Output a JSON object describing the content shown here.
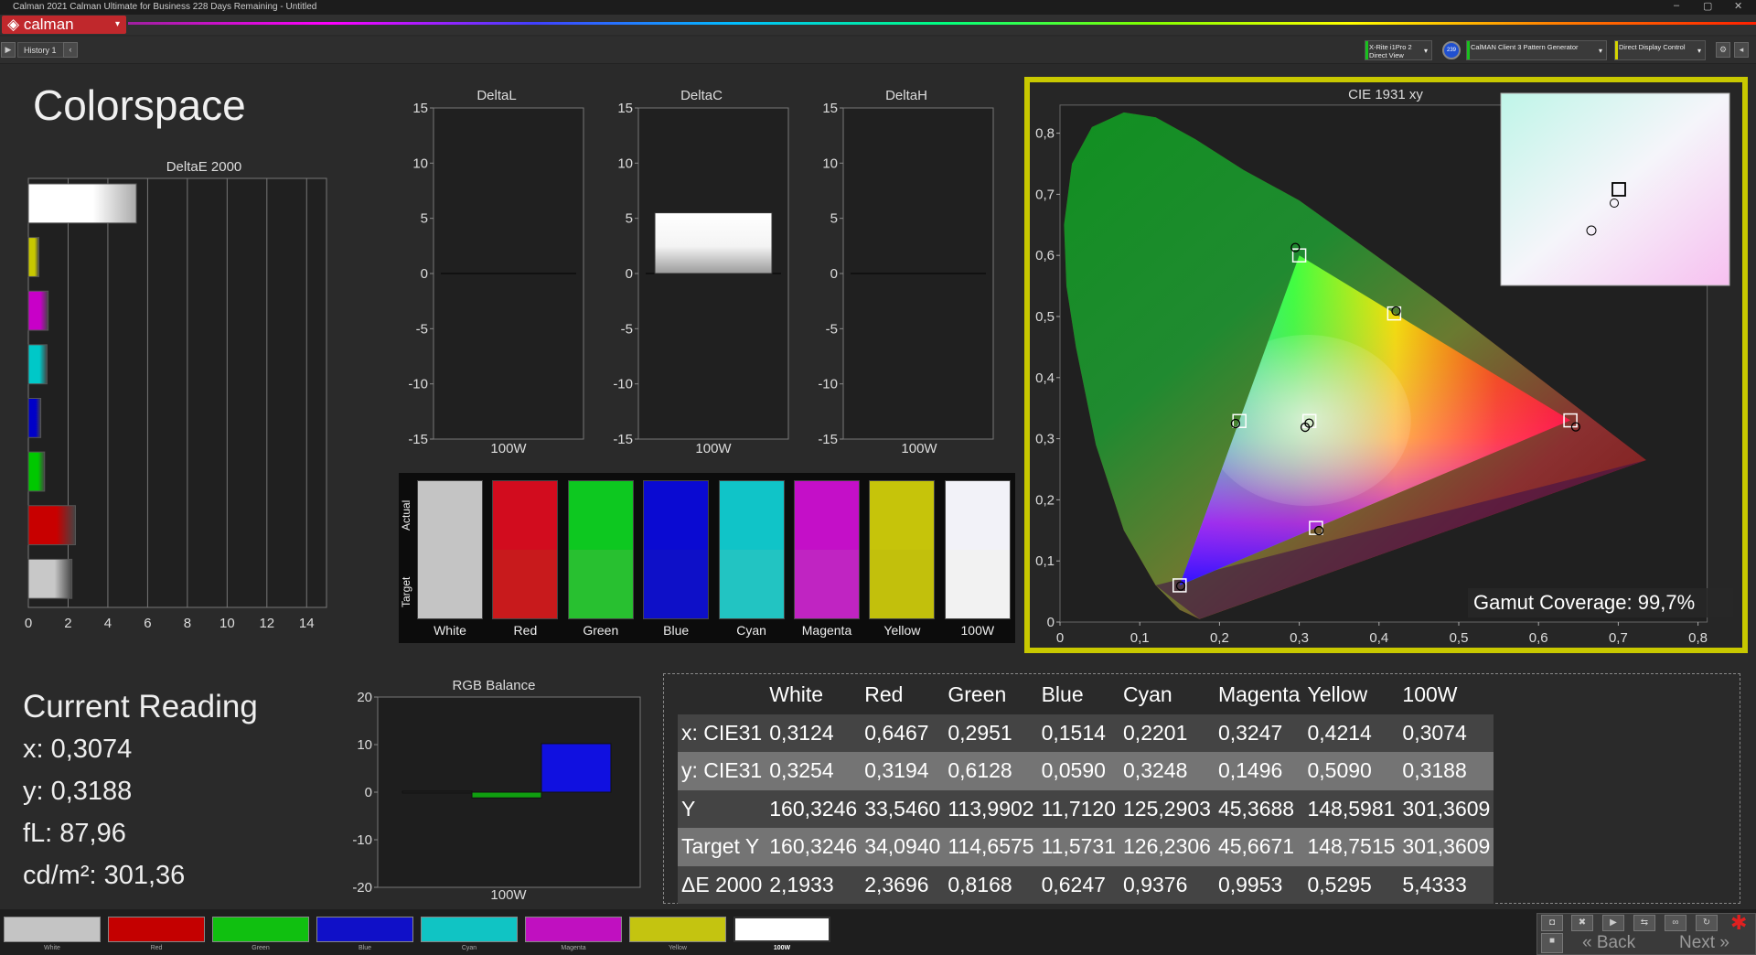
{
  "window": {
    "title": "Calman 2021 Calman Ultimate for Business 228 Days Remaining  - Untitled",
    "minimize": "–",
    "maximize": "▢",
    "close": "✕"
  },
  "brand": {
    "logo": "calman",
    "logo_arrow": "▾"
  },
  "toolbar": {
    "back_arrow": "▶",
    "history_tab": "History 1",
    "history_tab_button": "‹",
    "devices": [
      {
        "line1": "X-Rite i1Pro 2",
        "line2": "Direct View",
        "color": "#19c01e"
      },
      {
        "line1": "CalMAN Client 3 Pattern Generator",
        "line2": "",
        "color": "#19c01e"
      },
      {
        "line1": "Direct Display Control",
        "line2": "",
        "color": "#d6d600"
      }
    ],
    "device_round_label": "239"
  },
  "page": {
    "title": "Colorspace"
  },
  "deltae": {
    "title": "DeltaE 2000",
    "ticks": [
      "0",
      "2",
      "4",
      "6",
      "8",
      "10",
      "12",
      "14"
    ],
    "xlim": [
      0,
      15
    ]
  },
  "deltas": {
    "ticks": [
      "15",
      "10",
      "5",
      "0",
      "-5",
      "-10",
      "-15"
    ],
    "charts": [
      {
        "title": "DeltaL",
        "label": "100W"
      },
      {
        "title": "DeltaC",
        "label": "100W"
      },
      {
        "title": "DeltaH",
        "label": "100W"
      }
    ]
  },
  "swatches": {
    "actual_label": "Actual",
    "target_label": "Target",
    "items": [
      {
        "label": "White",
        "actual": "#c4c4c4",
        "target": "#c4c4c4"
      },
      {
        "label": "Red",
        "actual": "#d20c1e",
        "target": "#c81a1c"
      },
      {
        "label": "Green",
        "actual": "#0dc820",
        "target": "#28c030"
      },
      {
        "label": "Blue",
        "actual": "#0a0ad2",
        "target": "#0e10c8"
      },
      {
        "label": "Cyan",
        "actual": "#10c4c8",
        "target": "#22c4c2"
      },
      {
        "label": "Magenta",
        "actual": "#c40fc8",
        "target": "#c024c2"
      },
      {
        "label": "Yellow",
        "actual": "#c6c40a",
        "target": "#c2c00c"
      },
      {
        "label": "100W",
        "actual": "#f2f2f8",
        "target": "#f2f2f2"
      }
    ]
  },
  "cie": {
    "title": "CIE 1931 xy",
    "xticks": [
      "0",
      "0,1",
      "0,2",
      "0,3",
      "0,4",
      "0,5",
      "0,6",
      "0,7",
      "0,8"
    ],
    "yticks": [
      "0",
      "0,1",
      "0,2",
      "0,3",
      "0,4",
      "0,5",
      "0,6",
      "0,7",
      "0,8"
    ],
    "gamut_coverage_label": "Gamut Coverage:",
    "gamut_coverage_value": "99,7%"
  },
  "current_reading": {
    "title": "Current Reading",
    "x": "x: 0,3074",
    "y": "y: 0,3188",
    "fL": "fL: 87,96",
    "cdm2": "cd/m²: 301,36"
  },
  "rgb_balance": {
    "title": "RGB Balance",
    "ticks": [
      "20",
      "10",
      "0",
      "-10",
      "-20"
    ],
    "label": "100W",
    "ylim": [
      -20,
      20
    ],
    "values": {
      "red": 0.2,
      "green": -1.2,
      "blue": 10.2
    }
  },
  "table": {
    "headers": [
      "",
      "White",
      "Red",
      "Green",
      "Blue",
      "Cyan",
      "Magenta",
      "Yellow",
      "100W"
    ],
    "rows": [
      [
        "x: CIE31",
        "0,3124",
        "0,6467",
        "0,2951",
        "0,1514",
        "0,2201",
        "0,3247",
        "0,4214",
        "0,3074"
      ],
      [
        "y: CIE31",
        "0,3254",
        "0,3194",
        "0,6128",
        "0,0590",
        "0,3248",
        "0,1496",
        "0,5090",
        "0,3188"
      ],
      [
        "Y",
        "160,3246",
        "33,5460",
        "113,9902",
        "11,7120",
        "125,2903",
        "45,3688",
        "148,5981",
        "301,3609"
      ],
      [
        "Target Y",
        "160,3246",
        "34,0940",
        "114,6575",
        "11,5731",
        "126,2306",
        "45,6671",
        "148,7515",
        "301,3609"
      ],
      [
        "ΔE 2000",
        "2,1933",
        "2,3696",
        "0,8168",
        "0,6247",
        "0,9376",
        "0,9953",
        "0,5295",
        "5,4333"
      ]
    ]
  },
  "bottom": {
    "swatches": [
      {
        "label": "White",
        "color": "#c4c4c4"
      },
      {
        "label": "Red",
        "color": "#c40000"
      },
      {
        "label": "Green",
        "color": "#10c010"
      },
      {
        "label": "Blue",
        "color": "#1010c8"
      },
      {
        "label": "Cyan",
        "color": "#10c4c4"
      },
      {
        "label": "Magenta",
        "color": "#c010c0"
      },
      {
        "label": "Yellow",
        "color": "#c4c410"
      },
      {
        "label": "100W",
        "color": "#ffffff"
      }
    ],
    "back": "Back",
    "next": "Next",
    "back_arrow": "«",
    "next_arrow": "»"
  },
  "chart_data": [
    {
      "type": "bar",
      "title": "DeltaE 2000",
      "orientation": "horizontal",
      "categories": [
        "100W",
        "Yellow",
        "Magenta",
        "Cyan",
        "Blue",
        "Green",
        "Red",
        "White"
      ],
      "values": [
        5.4333,
        0.5295,
        0.9953,
        0.9376,
        0.6247,
        0.8168,
        2.3696,
        2.1933
      ],
      "colors": [
        "#ffffff",
        "#c8c800",
        "#c800c8",
        "#00c8c8",
        "#0000c8",
        "#00c800",
        "#c80000",
        "#c8c8c8"
      ],
      "xlim": [
        0,
        15
      ]
    },
    {
      "type": "bar",
      "title": "DeltaL",
      "categories": [
        "100W"
      ],
      "values": [
        0
      ],
      "ylim": [
        -15,
        15
      ]
    },
    {
      "type": "bar",
      "title": "DeltaC",
      "categories": [
        "100W"
      ],
      "values": [
        5.5
      ],
      "ylim": [
        -15,
        15
      ]
    },
    {
      "type": "bar",
      "title": "DeltaH",
      "categories": [
        "100W"
      ],
      "values": [
        0
      ],
      "ylim": [
        -15,
        15
      ]
    },
    {
      "type": "bar",
      "title": "RGB Balance",
      "categories": [
        "100W"
      ],
      "series": [
        {
          "values": [
            0.2
          ],
          "color": "#222222"
        },
        {
          "values": [
            -1.2
          ],
          "color": "#10a010"
        },
        {
          "values": [
            10.2
          ],
          "color": "#1010e0"
        }
      ],
      "ylim": [
        -20,
        20
      ]
    },
    {
      "type": "scatter",
      "title": "CIE 1931 xy",
      "xlim": [
        0,
        0.8
      ],
      "ylim": [
        0,
        0.8
      ],
      "target_gamut": [
        [
          0.64,
          0.33
        ],
        [
          0.3,
          0.6
        ],
        [
          0.15,
          0.06
        ]
      ],
      "targets": [
        {
          "name": "White",
          "x": 0.3127,
          "y": 0.329
        },
        {
          "name": "Red",
          "x": 0.64,
          "y": 0.33
        },
        {
          "name": "Green",
          "x": 0.3,
          "y": 0.6
        },
        {
          "name": "Blue",
          "x": 0.15,
          "y": 0.06
        },
        {
          "name": "Cyan",
          "x": 0.225,
          "y": 0.329
        },
        {
          "name": "Magenta",
          "x": 0.321,
          "y": 0.154
        },
        {
          "name": "Yellow",
          "x": 0.419,
          "y": 0.505
        }
      ],
      "measured": [
        {
          "name": "White",
          "x": 0.3124,
          "y": 0.3254
        },
        {
          "name": "Red",
          "x": 0.6467,
          "y": 0.3194
        },
        {
          "name": "Green",
          "x": 0.2951,
          "y": 0.6128
        },
        {
          "name": "Blue",
          "x": 0.1514,
          "y": 0.059
        },
        {
          "name": "Cyan",
          "x": 0.2201,
          "y": 0.3248
        },
        {
          "name": "Magenta",
          "x": 0.3247,
          "y": 0.1496
        },
        {
          "name": "Yellow",
          "x": 0.4214,
          "y": 0.509
        },
        {
          "name": "100W",
          "x": 0.3074,
          "y": 0.3188
        }
      ]
    }
  ]
}
